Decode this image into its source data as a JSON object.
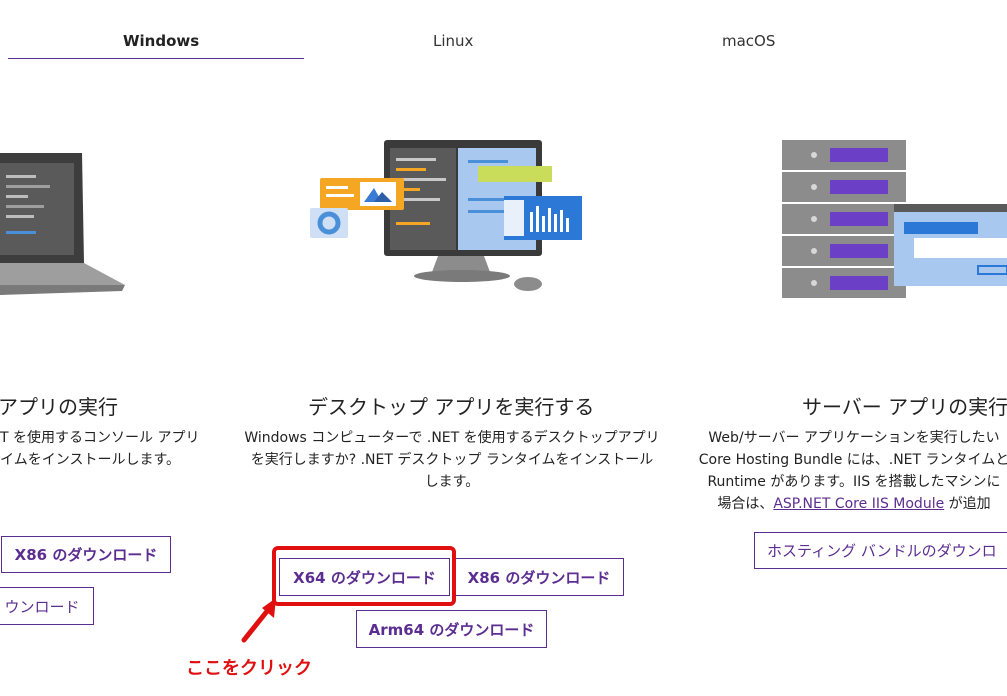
{
  "tabs": [
    {
      "label": "Windows",
      "active": true
    },
    {
      "label": "Linux",
      "active": false
    },
    {
      "label": "macOS",
      "active": false
    }
  ],
  "left": {
    "title": "アプリの実行",
    "desc_line1": "T を使用するコンソール アプリ",
    "desc_line2": "イムをインストールします。",
    "btn_x86": "X86 のダウンロード",
    "btn_partial": "ウンロード"
  },
  "center": {
    "title": "デスクトップ アプリを実行する",
    "desc_line1": "Windows コンピューターで .NET を使用するデスクトップアプリ",
    "desc_line2": "を実行しますか? .NET デスクトップ ランタイムをインストール",
    "desc_line3": "します。",
    "btn_x64": "X64 のダウンロード",
    "btn_x86": "X86 のダウンロード",
    "btn_arm64": "Arm64 のダウンロード"
  },
  "right": {
    "title": "サーバー アプリの実行",
    "desc_line1": "Web/サーバー アプリケーションを実行したい",
    "desc_line2": "Core Hosting Bundle には、.NET ランタイムと",
    "desc_line3": "Runtime があります。IIS を搭載したマシンに",
    "desc_line4a": "場合は、",
    "desc_link": "ASP.NET Core IIS Module",
    "desc_line4b": " が追加",
    "btn_hosting": "ホスティング バンドルのダウンロ"
  },
  "annotation": {
    "callout": "ここをクリック",
    "highlight_color": "#e01010"
  },
  "colors": {
    "accent": "#5c2d91",
    "annotation": "#e01010"
  }
}
